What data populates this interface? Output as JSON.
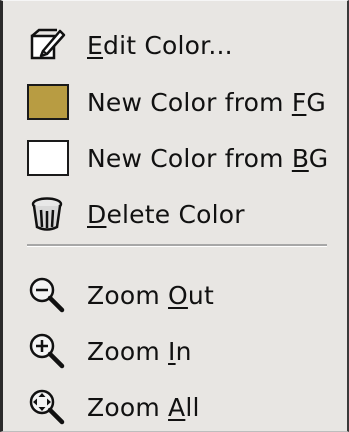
{
  "menu": {
    "items": [
      {
        "pre": "",
        "mnemonic": "E",
        "post": "dit Color...",
        "icon": "edit-pen-icon"
      },
      {
        "pre": "New Color from ",
        "mnemonic": "F",
        "post": "G",
        "icon": "fg-swatch-icon",
        "swatch_color": "#b89c42"
      },
      {
        "pre": "New Color from ",
        "mnemonic": "B",
        "post": "G",
        "icon": "bg-swatch-icon",
        "swatch_color": "#ffffff"
      },
      {
        "pre": "",
        "mnemonic": "D",
        "post": "elete Color",
        "icon": "trash-icon"
      },
      {
        "pre": "Zoom ",
        "mnemonic": "O",
        "post": "ut",
        "icon": "zoom-out-icon"
      },
      {
        "pre": "Zoom ",
        "mnemonic": "I",
        "post": "n",
        "icon": "zoom-in-icon"
      },
      {
        "pre": "Zoom ",
        "mnemonic": "A",
        "post": "ll",
        "icon": "zoom-all-icon"
      }
    ]
  }
}
